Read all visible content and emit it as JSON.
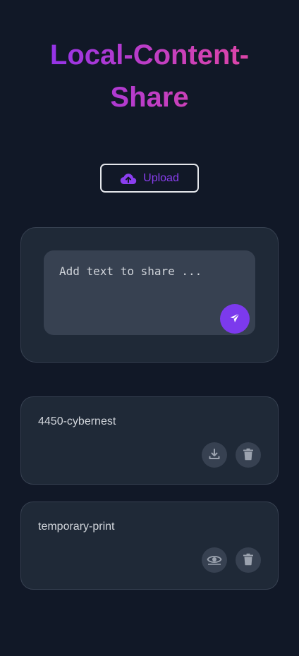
{
  "header": {
    "title_line1": "Local-Content-",
    "title_line2": "Share"
  },
  "upload": {
    "label": "Upload",
    "icon": "cloud-upload-icon"
  },
  "composer": {
    "placeholder": "Add text to share ...",
    "send_icon": "send-icon"
  },
  "items": [
    {
      "name": "4450-cybernest",
      "actions": [
        "download-icon",
        "trash-icon"
      ]
    },
    {
      "name": "temporary-print",
      "actions": [
        "eye-icon",
        "trash-icon"
      ]
    }
  ],
  "colors": {
    "background": "#111827",
    "card": "#1f2937",
    "input": "#374151",
    "accent": "#7c3aed",
    "title_gradient_start": "#9333ea",
    "title_gradient_end": "#ec4899"
  }
}
